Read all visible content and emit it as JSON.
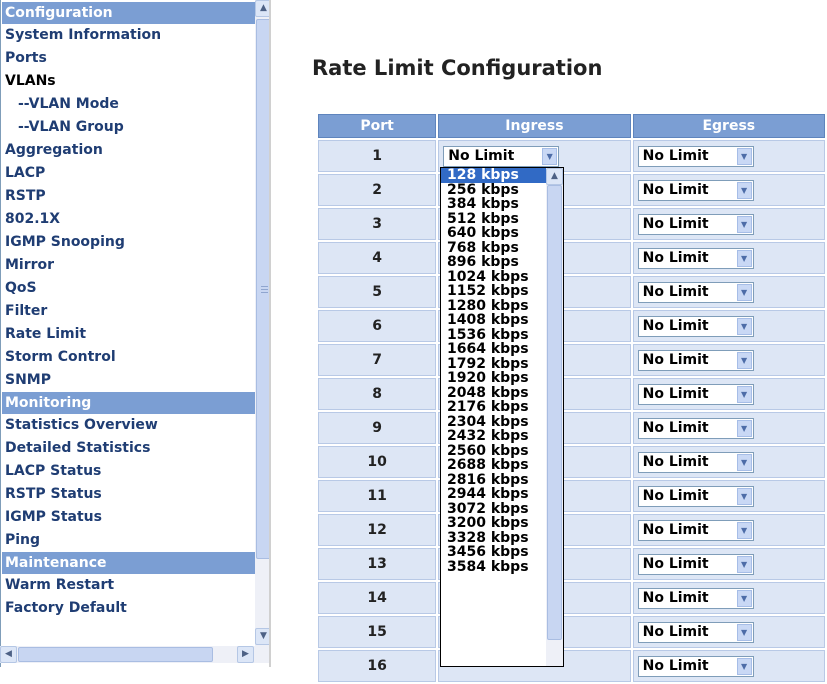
{
  "nav": {
    "items": [
      {
        "label": "Configuration",
        "type": "header"
      },
      {
        "label": "System Information",
        "type": "link"
      },
      {
        "label": "Ports",
        "type": "link"
      },
      {
        "label": "VLANs",
        "type": "link",
        "active": true
      },
      {
        "label": "--VLAN Mode",
        "type": "sub"
      },
      {
        "label": "--VLAN Group",
        "type": "sub"
      },
      {
        "label": "Aggregation",
        "type": "link"
      },
      {
        "label": "LACP",
        "type": "link"
      },
      {
        "label": "RSTP",
        "type": "link"
      },
      {
        "label": "802.1X",
        "type": "link"
      },
      {
        "label": "IGMP Snooping",
        "type": "link"
      },
      {
        "label": "Mirror",
        "type": "link"
      },
      {
        "label": "QoS",
        "type": "link"
      },
      {
        "label": "Filter",
        "type": "link"
      },
      {
        "label": "Rate Limit",
        "type": "link"
      },
      {
        "label": "Storm Control",
        "type": "link"
      },
      {
        "label": "SNMP",
        "type": "link"
      },
      {
        "label": "Monitoring",
        "type": "header"
      },
      {
        "label": "Statistics Overview",
        "type": "link"
      },
      {
        "label": "Detailed Statistics",
        "type": "link"
      },
      {
        "label": "LACP Status",
        "type": "link"
      },
      {
        "label": "RSTP Status",
        "type": "link"
      },
      {
        "label": "IGMP Status",
        "type": "link"
      },
      {
        "label": "Ping",
        "type": "link"
      },
      {
        "label": "Maintenance",
        "type": "header"
      },
      {
        "label": "Warm Restart",
        "type": "link"
      },
      {
        "label": "Factory Default",
        "type": "link"
      }
    ]
  },
  "page": {
    "title": "Rate Limit Configuration"
  },
  "table": {
    "headers": [
      "Port",
      "Ingress",
      "Egress"
    ],
    "rows": [
      {
        "port": "1",
        "ingress": "No Limit",
        "egress": "No Limit"
      },
      {
        "port": "2",
        "ingress": "",
        "egress": "No Limit"
      },
      {
        "port": "3",
        "ingress": "",
        "egress": "No Limit"
      },
      {
        "port": "4",
        "ingress": "",
        "egress": "No Limit"
      },
      {
        "port": "5",
        "ingress": "",
        "egress": "No Limit"
      },
      {
        "port": "6",
        "ingress": "",
        "egress": "No Limit"
      },
      {
        "port": "7",
        "ingress": "",
        "egress": "No Limit"
      },
      {
        "port": "8",
        "ingress": "",
        "egress": "No Limit"
      },
      {
        "port": "9",
        "ingress": "",
        "egress": "No Limit"
      },
      {
        "port": "10",
        "ingress": "",
        "egress": "No Limit"
      },
      {
        "port": "11",
        "ingress": "",
        "egress": "No Limit"
      },
      {
        "port": "12",
        "ingress": "",
        "egress": "No Limit"
      },
      {
        "port": "13",
        "ingress": "",
        "egress": "No Limit"
      },
      {
        "port": "14",
        "ingress": "",
        "egress": "No Limit"
      },
      {
        "port": "15",
        "ingress": "",
        "egress": "No Limit"
      },
      {
        "port": "16",
        "ingress": "",
        "egress": "No Limit"
      }
    ]
  },
  "dropdown": {
    "highlighted": "128 kbps",
    "options": [
      "128 kbps",
      "256 kbps",
      "384 kbps",
      "512 kbps",
      "640 kbps",
      "768 kbps",
      "896 kbps",
      "1024 kbps",
      "1152 kbps",
      "1280 kbps",
      "1408 kbps",
      "1536 kbps",
      "1664 kbps",
      "1792 kbps",
      "1920 kbps",
      "2048 kbps",
      "2176 kbps",
      "2304 kbps",
      "2432 kbps",
      "2560 kbps",
      "2688 kbps",
      "2816 kbps",
      "2944 kbps",
      "3072 kbps",
      "3200 kbps",
      "3328 kbps",
      "3456 kbps",
      "3584 kbps"
    ]
  },
  "icons": {
    "scroll_up": "chevron-up-icon",
    "scroll_down": "chevron-down-icon",
    "scroll_left": "chevron-left-icon",
    "scroll_right": "chevron-right-icon",
    "select_arrow": "chevron-down-icon"
  },
  "colors": {
    "header_bg": "#7b9ed3",
    "cell_bg": "#dde6f5",
    "nav_link": "#1f3d73",
    "selection": "#316ac5"
  }
}
